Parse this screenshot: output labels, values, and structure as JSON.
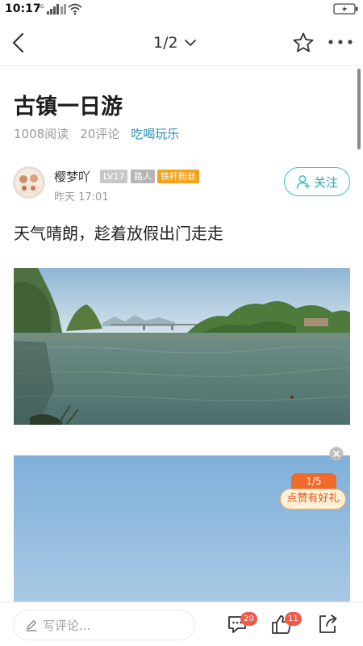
{
  "status_bar": {
    "time": "10:17",
    "network": "4G"
  },
  "header": {
    "page_indicator": "1/2",
    "icons": [
      "back-icon",
      "chevron-down-icon",
      "star-icon",
      "more-icon"
    ]
  },
  "article": {
    "title": "古镇一日游",
    "reads": "1008阅读",
    "comments": "20评论",
    "category": "吃喝玩乐",
    "author": {
      "name": "樱梦吖",
      "level": "LV17",
      "role": "路人",
      "fan_badge": "铁杆粉丝",
      "time": "昨天 17:01"
    },
    "follow_label": "关注",
    "text": "天气晴朗，趁着放假出门走走"
  },
  "promo": {
    "counter": "1/5",
    "button_label": "点赞有好礼"
  },
  "bottom_bar": {
    "comment_placeholder": "写评论...",
    "comment_count": "20",
    "like_count": "11",
    "icons": [
      "pencil-icon",
      "comments-icon",
      "like-icon",
      "share-icon"
    ]
  },
  "colors": {
    "accent_teal": "#35c0c9",
    "category_blue": "#2b8fb0",
    "fan_badge_orange": "#f3a21b",
    "count_badge_red": "#f05a4a",
    "promo_orange": "#f06a2b"
  }
}
